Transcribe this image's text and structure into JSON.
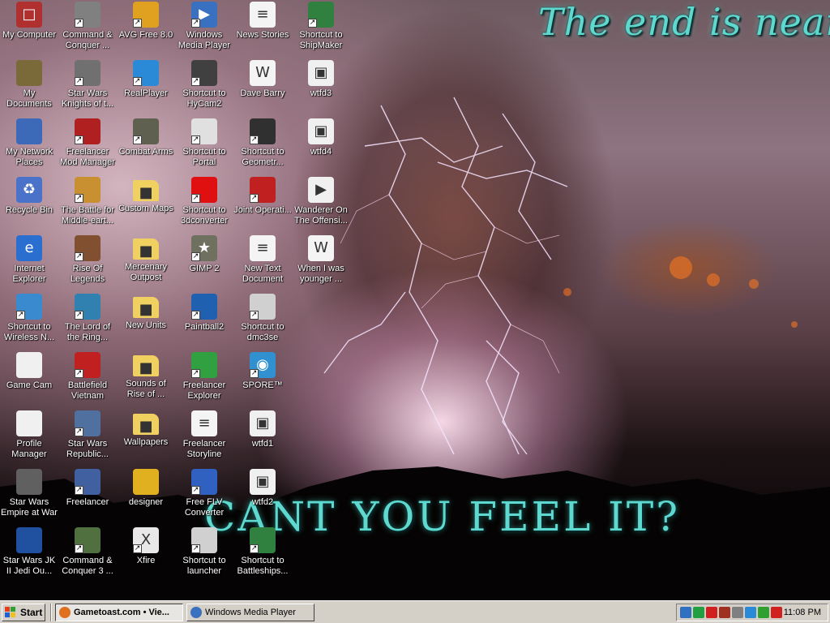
{
  "wallpaper": {
    "title": "The end is near...",
    "subtitle": "CANT YOU FEEL IT?"
  },
  "desktop_icons": [
    {
      "label": "My Computer",
      "icon": "my-computer-icon",
      "color": "#b03030",
      "shortcut": false
    },
    {
      "label": "My Documents",
      "icon": "my-documents-icon",
      "color": "#7a6a3a",
      "shortcut": false
    },
    {
      "label": "My Network Places",
      "icon": "network-places-icon",
      "color": "#3c6ab8",
      "shortcut": false
    },
    {
      "label": "Recycle Bin",
      "icon": "recycle-bin-icon",
      "color": "#4a72c8",
      "shortcut": false
    },
    {
      "label": "Internet Explorer",
      "icon": "internet-explorer-icon",
      "color": "#2a6fd0",
      "shortcut": false
    },
    {
      "label": "Shortcut to Wireless N...",
      "icon": "wireless-network-icon",
      "color": "#3a8ad0",
      "shortcut": true
    },
    {
      "label": "Game Cam",
      "icon": "game-cam-icon",
      "color": "#f0f0f0",
      "shortcut": false
    },
    {
      "label": "Profile Manager",
      "icon": "profile-manager-icon",
      "color": "#f0f0f0",
      "shortcut": false
    },
    {
      "label": "Star Wars Empire at War",
      "icon": "empire-at-war-icon",
      "color": "#606060",
      "shortcut": false
    },
    {
      "label": "Star Wars JK II Jedi Ou...",
      "icon": "jedi-outcast-icon",
      "color": "#2050a0",
      "shortcut": false
    },
    {
      "label": "Command & Conquer ...",
      "icon": "command-conquer-icon",
      "color": "#808080",
      "shortcut": true
    },
    {
      "label": "Star Wars Knights of t...",
      "icon": "kotor-icon",
      "color": "#707070",
      "shortcut": true
    },
    {
      "label": "Freelancer Mod Manager",
      "icon": "mod-manager-icon",
      "color": "#b02020",
      "shortcut": true
    },
    {
      "label": "The Battle for Middle-eart...",
      "icon": "battle-middle-earth-icon",
      "color": "#c89030",
      "shortcut": true
    },
    {
      "label": "Rise Of Legends",
      "icon": "rise-of-legends-icon",
      "color": "#805030",
      "shortcut": true
    },
    {
      "label": "The Lord of the Ring...",
      "icon": "lord-of-the-rings-icon",
      "color": "#3080b0",
      "shortcut": true
    },
    {
      "label": "Battlefield Vietnam",
      "icon": "battlefield-vietnam-icon",
      "color": "#c02020",
      "shortcut": true
    },
    {
      "label": "Star Wars Republic...",
      "icon": "republic-commando-icon",
      "color": "#5070a0",
      "shortcut": true
    },
    {
      "label": "Freelancer",
      "icon": "freelancer-icon",
      "color": "#4060a0",
      "shortcut": true
    },
    {
      "label": "Command & Conquer 3 ...",
      "icon": "command-conquer-3-icon",
      "color": "#507040",
      "shortcut": true
    },
    {
      "label": "AVG Free 8.0",
      "icon": "avg-icon",
      "color": "#e0a020",
      "shortcut": true
    },
    {
      "label": "RealPlayer",
      "icon": "realplayer-icon",
      "color": "#2a8ad8",
      "shortcut": true
    },
    {
      "label": "Combat Arms",
      "icon": "combat-arms-icon",
      "color": "#606050",
      "shortcut": true
    },
    {
      "label": "Custom Maps",
      "icon": "folder-icon",
      "color": "#f0d060",
      "shortcut": false
    },
    {
      "label": "Mercenary Outpost",
      "icon": "folder-icon",
      "color": "#f0d060",
      "shortcut": false
    },
    {
      "label": "New Units",
      "icon": "folder-icon",
      "color": "#f0d060",
      "shortcut": false
    },
    {
      "label": "Sounds of Rise of ...",
      "icon": "folder-icon",
      "color": "#f0d060",
      "shortcut": false
    },
    {
      "label": "Wallpapers",
      "icon": "folder-icon",
      "color": "#f0d060",
      "shortcut": false
    },
    {
      "label": "designer",
      "icon": "designer-icon",
      "color": "#e0b020",
      "shortcut": false
    },
    {
      "label": "Xfire",
      "icon": "xfire-icon",
      "color": "#e8e8e8",
      "shortcut": true
    },
    {
      "label": "Windows Media Player",
      "icon": "media-player-icon",
      "color": "#3a70c0",
      "shortcut": true
    },
    {
      "label": "Shortcut to HyCam2",
      "icon": "hycam-icon",
      "color": "#404040",
      "shortcut": true
    },
    {
      "label": "Shortcut to Portal",
      "icon": "portal-icon",
      "color": "#e0e0e0",
      "shortcut": true
    },
    {
      "label": "Shortcut to 3dconverter",
      "icon": "3dconverter-icon",
      "color": "#e01010",
      "shortcut": true
    },
    {
      "label": "GIMP 2",
      "icon": "gimp-icon",
      "color": "#707060",
      "shortcut": true
    },
    {
      "label": "Paintball2",
      "icon": "paintball-icon",
      "color": "#2060b0",
      "shortcut": true
    },
    {
      "label": "Freelancer Explorer",
      "icon": "freelancer-explorer-icon",
      "color": "#30a040",
      "shortcut": true
    },
    {
      "label": "Freelancer Storyline",
      "icon": "text-document-icon",
      "color": "#f4f4f4",
      "shortcut": false
    },
    {
      "label": "Free FLV Converter",
      "icon": "flv-converter-icon",
      "color": "#3060c0",
      "shortcut": true
    },
    {
      "label": "Shortcut to launcher",
      "icon": "launcher-icon",
      "color": "#d0d0d0",
      "shortcut": true
    },
    {
      "label": "News Stories",
      "icon": "text-document-icon",
      "color": "#f4f4f4",
      "shortcut": false
    },
    {
      "label": "Dave Barry",
      "icon": "word-document-icon",
      "color": "#f4f4f4",
      "shortcut": false
    },
    {
      "label": "Shortcut to Geometr...",
      "icon": "geometry-wars-icon",
      "color": "#303030",
      "shortcut": true
    },
    {
      "label": "Joint Operati...",
      "icon": "joint-operations-icon",
      "color": "#c02020",
      "shortcut": true
    },
    {
      "label": "New Text Document",
      "icon": "text-document-icon",
      "color": "#f4f4f4",
      "shortcut": false
    },
    {
      "label": "Shortcut to dmc3se",
      "icon": "dmc3se-icon",
      "color": "#d0d0d0",
      "shortcut": true
    },
    {
      "label": "SPORE™",
      "icon": "spore-icon",
      "color": "#3090d0",
      "shortcut": true
    },
    {
      "label": "wtfd1",
      "icon": "image-file-icon",
      "color": "#f0f0f0",
      "shortcut": false
    },
    {
      "label": "wtfd2",
      "icon": "image-file-icon",
      "color": "#f0f0f0",
      "shortcut": false
    },
    {
      "label": "Shortcut to Battleships...",
      "icon": "battleships-icon",
      "color": "#308040",
      "shortcut": true
    },
    {
      "label": "Shortcut to ShipMaker",
      "icon": "shipmaker-icon",
      "color": "#308040",
      "shortcut": true
    },
    {
      "label": "wtfd3",
      "icon": "image-file-icon",
      "color": "#f0f0f0",
      "shortcut": false
    },
    {
      "label": "wtfd4",
      "icon": "image-file-icon",
      "color": "#f0f0f0",
      "shortcut": false
    },
    {
      "label": "Wanderer On The Offensi...",
      "icon": "avi-file-icon",
      "color": "#f0f0f0",
      "shortcut": false
    },
    {
      "label": "When I was younger ...",
      "icon": "word-document-icon",
      "color": "#f4f4f4",
      "shortcut": false
    }
  ],
  "taskbar": {
    "start_label": "Start",
    "tasks": [
      {
        "label": "Gametoast.com • Vie...",
        "icon": "firefox-icon",
        "active": true
      },
      {
        "label": "Windows Media Player",
        "icon": "media-player-icon",
        "active": false
      }
    ],
    "tray_icons": [
      "network-icon",
      "ati-icon",
      "network-error-icon",
      "antivirus-icon",
      "volume-icon",
      "realplayer-icon",
      "shield-icon",
      "xfire-icon"
    ],
    "clock": "11:08 PM"
  }
}
